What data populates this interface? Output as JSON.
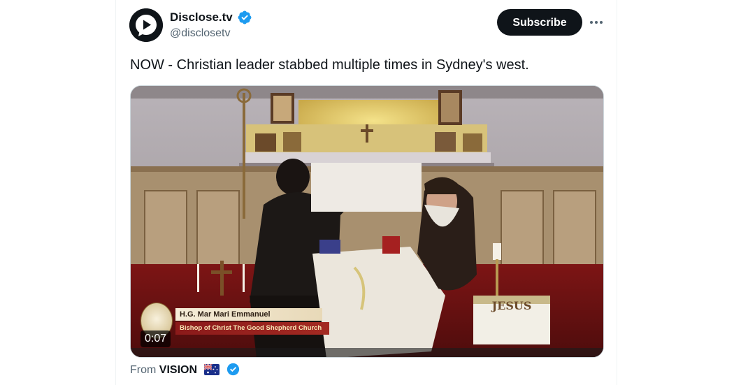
{
  "author": {
    "display_name": "Disclose.tv",
    "handle": "@disclosetv",
    "verified": true,
    "avatar_icon": "play-bubble-logo"
  },
  "actions": {
    "subscribe_label": "Subscribe",
    "more_icon": "more-horizontal-icon"
  },
  "tweet": {
    "text": "NOW - Christian leader stabbed multiple times in Sydney's west."
  },
  "video": {
    "timestamp": "0:07",
    "lower_third": {
      "name": "H.G. Mar Mari Emmanuel",
      "title": "Bishop of Christ The Good Shepherd Church"
    },
    "altar_text": "JESUS"
  },
  "attribution": {
    "prefix": "From",
    "source": "VISION",
    "flag": "australia-flag",
    "verified": true
  },
  "colors": {
    "text_primary": "#0f1419",
    "text_secondary": "#536471",
    "verified_blue": "#1d9bf0",
    "button_bg": "#0f1419"
  }
}
